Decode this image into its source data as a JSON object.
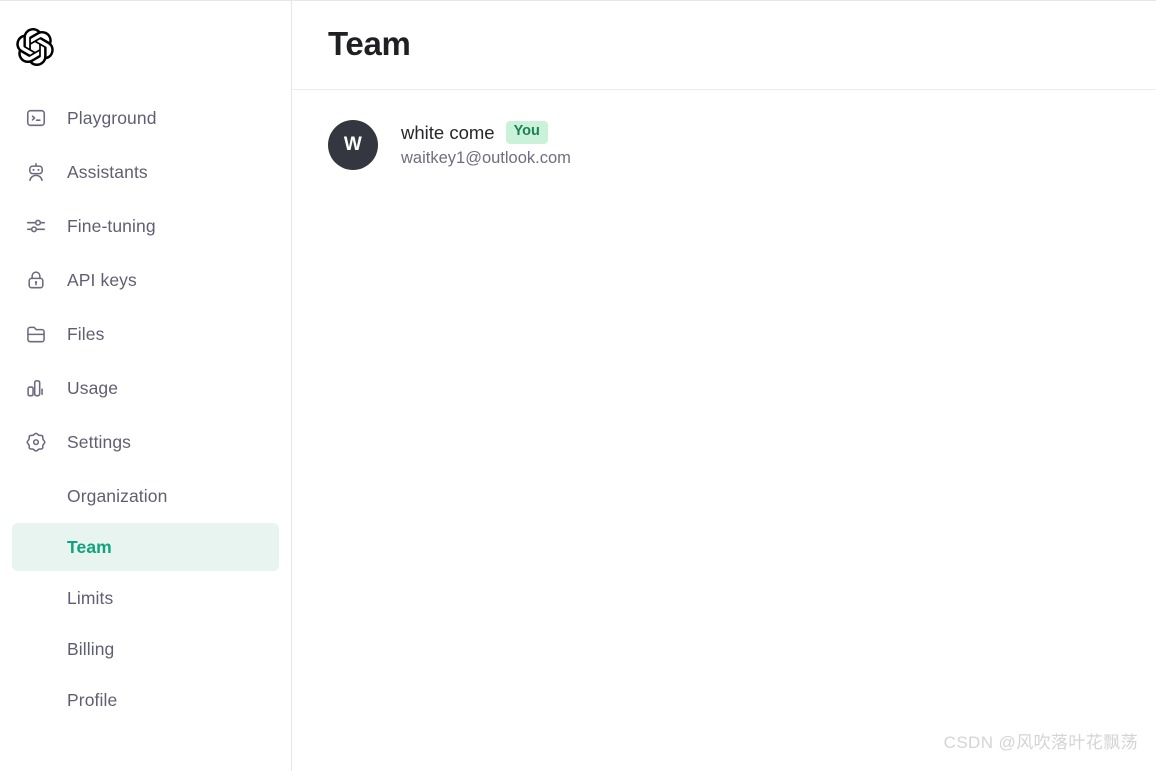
{
  "brand": {
    "logo_icon": "openai-logo-icon",
    "accent_color": "#10a37f",
    "active_pill_bg": "#e7f4ef",
    "badge_bg": "#c9f2d8",
    "badge_text_color": "#1d7f58",
    "avatar_bg": "#353740"
  },
  "sidebar": {
    "items": [
      {
        "label": "Playground",
        "icon": "terminal-icon"
      },
      {
        "label": "Assistants",
        "icon": "robot-icon"
      },
      {
        "label": "Fine-tuning",
        "icon": "sliders-icon"
      },
      {
        "label": "API keys",
        "icon": "lock-icon"
      },
      {
        "label": "Files",
        "icon": "folder-icon"
      },
      {
        "label": "Usage",
        "icon": "bar-chart-icon"
      },
      {
        "label": "Settings",
        "icon": "gear-icon"
      }
    ],
    "sub_items": [
      {
        "label": "Organization",
        "active": false
      },
      {
        "label": "Team",
        "active": true
      },
      {
        "label": "Limits",
        "active": false
      },
      {
        "label": "Billing",
        "active": false
      },
      {
        "label": "Profile",
        "active": false
      }
    ]
  },
  "main": {
    "title": "Team",
    "members": [
      {
        "avatar_initial": "W",
        "name": "white come",
        "badge": "You",
        "email": "waitkey1@outlook.com"
      }
    ]
  },
  "watermark": {
    "text": "CSDN @风吹落叶花飘荡"
  }
}
